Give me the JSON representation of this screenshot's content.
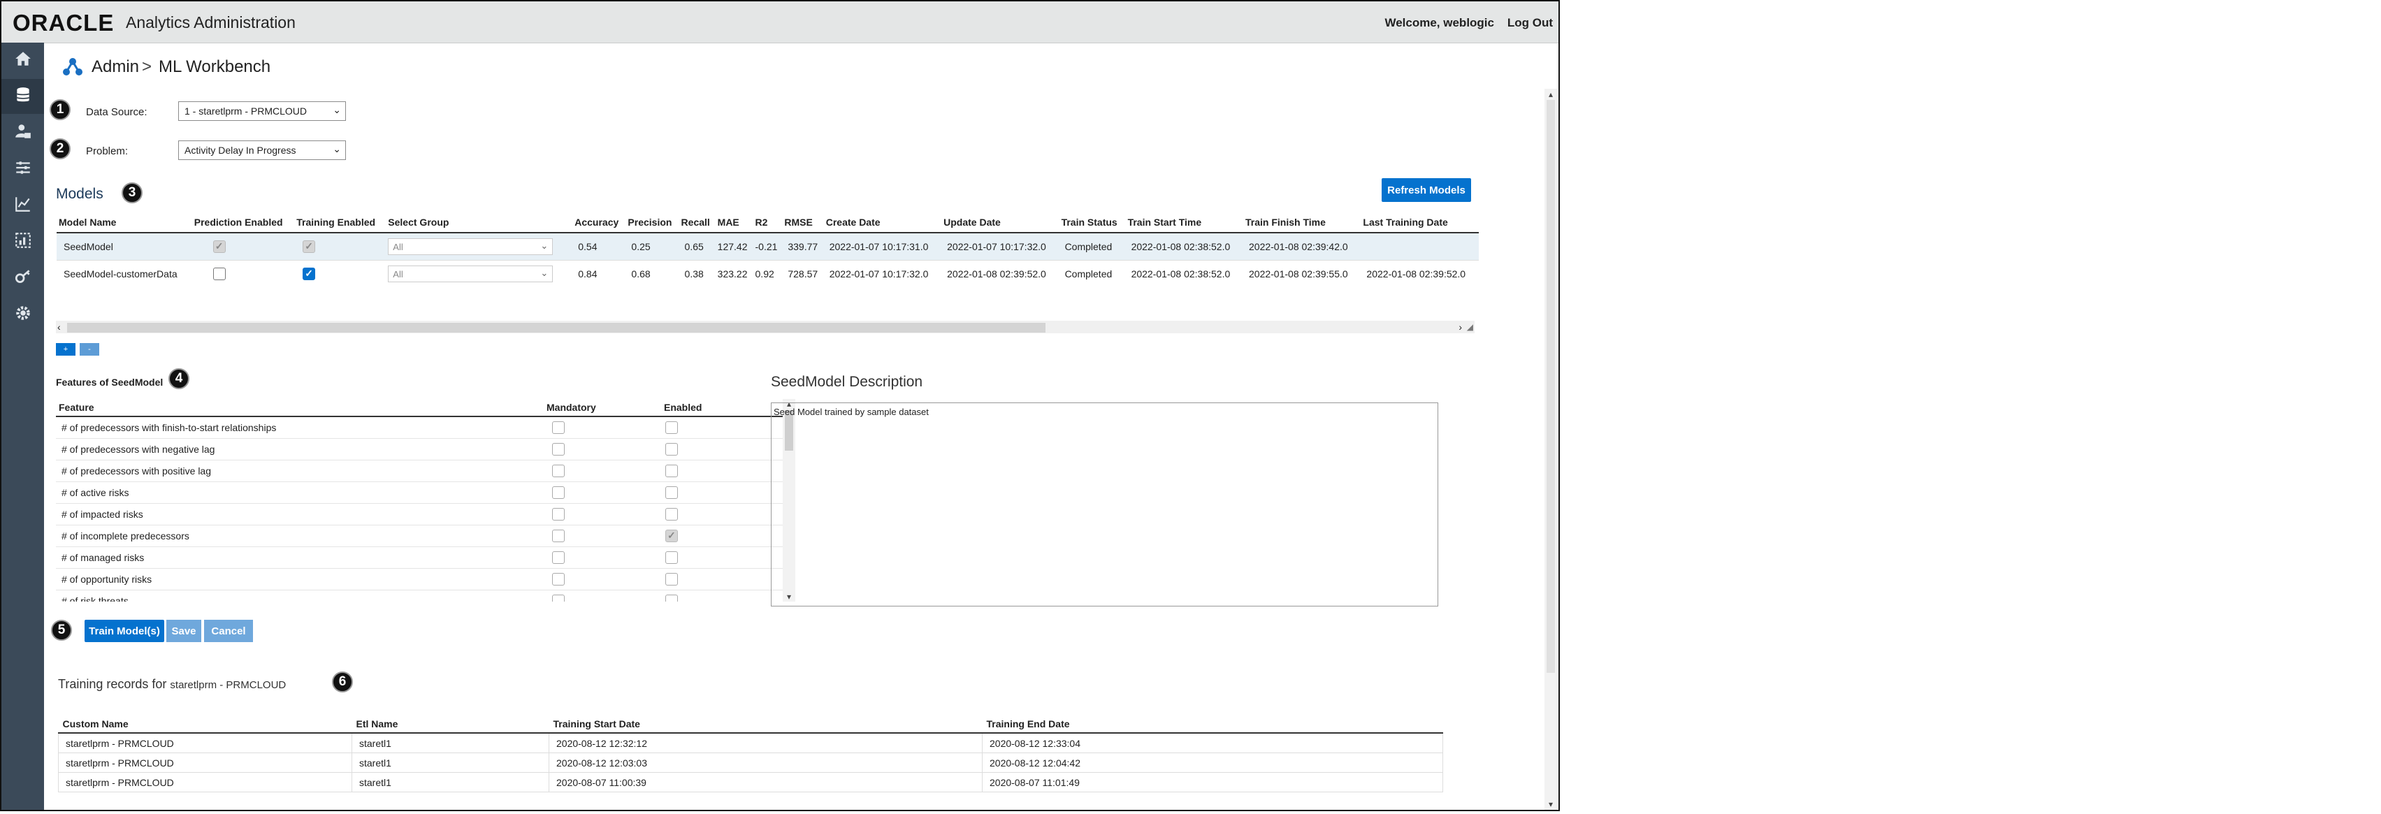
{
  "header": {
    "logo": "ORACLE",
    "app_title": "Analytics Administration",
    "welcome": "Welcome, weblogic",
    "logout": "Log Out"
  },
  "sidebar": {
    "items": [
      {
        "icon": "home-icon",
        "active": false
      },
      {
        "icon": "database-icon",
        "active": true
      },
      {
        "icon": "user-data-icon",
        "active": false
      },
      {
        "icon": "sliders-icon",
        "active": false
      },
      {
        "icon": "chart-line-icon",
        "active": false
      },
      {
        "icon": "grid-chart-icon",
        "active": false
      },
      {
        "icon": "keys-icon",
        "active": false
      },
      {
        "icon": "gear-icon",
        "active": false
      }
    ]
  },
  "breadcrumb": {
    "admin": "Admin",
    "separator": ">",
    "page": "ML Workbench"
  },
  "badges": [
    "1",
    "2",
    "3",
    "4",
    "5",
    "6"
  ],
  "data_source": {
    "label": "Data Source:",
    "value": "1 - staretlprm - PRMCLOUD"
  },
  "problem": {
    "label": "Problem:",
    "value": "Activity Delay In Progress"
  },
  "models": {
    "title": "Models",
    "refresh_label": "Refresh Models",
    "columns": [
      "Model Name",
      "Prediction Enabled",
      "Training Enabled",
      "Select Group",
      "Accuracy",
      "Precision",
      "Recall",
      "MAE",
      "R2",
      "RMSE",
      "Create Date",
      "Update Date",
      "Train Status",
      "Train Start Time",
      "Train Finish Time",
      "Last Training Date"
    ],
    "rows": [
      {
        "name": "SeedModel",
        "prediction_enabled": true,
        "training_enabled": true,
        "group": "All",
        "accuracy": "0.54",
        "precision": "0.25",
        "recall": "0.65",
        "mae": "127.42",
        "r2": "-0.21",
        "rmse": "339.77",
        "create_date": "2022-01-07 10:17:31.0",
        "update_date": "2022-01-07 10:17:32.0",
        "train_status": "Completed",
        "train_start": "2022-01-08 02:38:52.0",
        "train_finish": "2022-01-08 02:39:42.0",
        "last_training": ""
      },
      {
        "name": "SeedModel-customerData",
        "prediction_enabled": false,
        "training_enabled": true,
        "group": "All",
        "accuracy": "0.84",
        "precision": "0.68",
        "recall": "0.38",
        "mae": "323.22",
        "r2": "0.92",
        "rmse": "728.57",
        "create_date": "2022-01-07 10:17:32.0",
        "update_date": "2022-01-08 02:39:52.0",
        "train_status": "Completed",
        "train_start": "2022-01-08 02:38:52.0",
        "train_finish": "2022-01-08 02:39:55.0",
        "last_training": "2022-01-08 02:39:52.0"
      }
    ],
    "expand_label": "+",
    "collapse_label": "-"
  },
  "features": {
    "title": "Features of SeedModel",
    "columns": [
      "Feature",
      "Mandatory",
      "Enabled"
    ],
    "rows": [
      {
        "name": "# of predecessors with finish-to-start relationships",
        "mandatory": false,
        "enabled": false
      },
      {
        "name": "# of predecessors with negative lag",
        "mandatory": false,
        "enabled": false
      },
      {
        "name": "# of predecessors with positive lag",
        "mandatory": false,
        "enabled": false
      },
      {
        "name": "# of active risks",
        "mandatory": false,
        "enabled": false
      },
      {
        "name": "# of impacted risks",
        "mandatory": false,
        "enabled": false
      },
      {
        "name": "# of incomplete predecessors",
        "mandatory": false,
        "enabled": true
      },
      {
        "name": "# of managed risks",
        "mandatory": false,
        "enabled": false
      },
      {
        "name": "# of opportunity risks",
        "mandatory": false,
        "enabled": false
      },
      {
        "name": "# of risk threats",
        "mandatory": false,
        "enabled": false
      }
    ]
  },
  "description": {
    "title": "SeedModel Description",
    "text": "Seed Model trained by sample dataset"
  },
  "actions": {
    "train_label": "Train Model(s)",
    "save_label": "Save",
    "cancel_label": "Cancel"
  },
  "training_records": {
    "title_prefix": "Training records for",
    "source": "staretlprm - PRMCLOUD",
    "columns": [
      "Custom Name",
      "Etl Name",
      "Training Start Date",
      "Training End Date"
    ],
    "rows": [
      {
        "custom_name": "staretlprm - PRMCLOUD",
        "etl_name": "staretl1",
        "start": "2020-08-12 12:32:12",
        "end": "2020-08-12 12:33:04"
      },
      {
        "custom_name": "staretlprm - PRMCLOUD",
        "etl_name": "staretl1",
        "start": "2020-08-12 12:03:03",
        "end": "2020-08-12 12:04:42"
      },
      {
        "custom_name": "staretlprm - PRMCLOUD",
        "etl_name": "staretl1",
        "start": "2020-08-07 11:00:39",
        "end": "2020-08-07 11:01:49"
      }
    ]
  },
  "colors": {
    "accent": "#0572ce",
    "sidebar": "#3b4a59",
    "header": "#e4e6e6",
    "selected_row": "#e7f0f6"
  }
}
